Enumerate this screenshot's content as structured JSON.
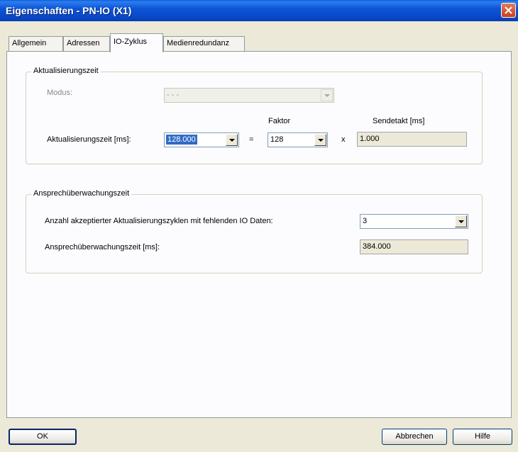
{
  "window": {
    "title": "Eigenschaften - PN-IO (X1)"
  },
  "tabs": [
    {
      "label": "Allgemein"
    },
    {
      "label": "Adressen"
    },
    {
      "label": "IO-Zyklus"
    },
    {
      "label": "Medienredundanz"
    }
  ],
  "aktualisierung": {
    "group_title": "Aktualisierungszeit",
    "modus_label": "Modus:",
    "modus_value": "- - -",
    "faktor_header": "Faktor",
    "sendetakt_header": "Sendetakt [ms]",
    "aktzeit_label": "Aktualisierungszeit [ms]:",
    "aktzeit_value": "128.000",
    "equals": "=",
    "faktor_value": "128",
    "times": "x",
    "sendetakt_value": "1.000"
  },
  "ansprech": {
    "group_title": "Ansprechüberwachungszeit",
    "zyklen_label": "Anzahl akzeptierter Aktualisierungszyklen mit fehlenden IO Daten:",
    "zyklen_value": "3",
    "zeit_label": "Ansprechüberwachungszeit [ms]:",
    "zeit_value": "384.000"
  },
  "buttons": {
    "ok": "OK",
    "cancel": "Abbrechen",
    "help": "Hilfe"
  }
}
